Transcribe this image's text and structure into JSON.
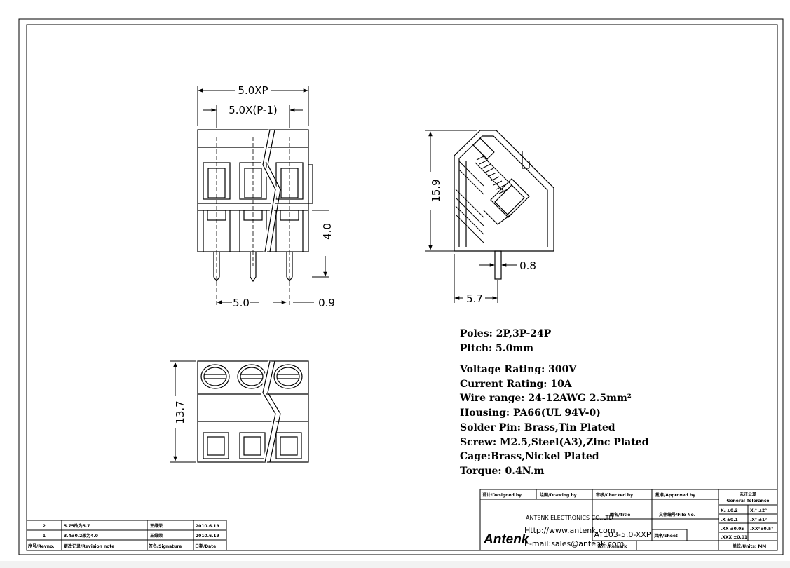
{
  "dimensions": {
    "total_width": "5.0XP",
    "inner_width": "5.0X(P-1)",
    "pitch": "5.0",
    "pin_diameter": "0.9",
    "pin_length": "4.0",
    "height": "15.9",
    "pin_width": "0.8",
    "pin_offset": "5.7",
    "depth": "13.7"
  },
  "specs": [
    "Poles: 2P,3P-24P",
    "Pitch: 5.0mm",
    "Voltage Rating: 300V",
    "Current Rating: 10A",
    "Wire range: 24-12AWG 2.5mm²",
    "Housing: PA66(UL 94V-0)",
    "Solder Pin: Brass,Tin Plated",
    "Screw: M2.5,Steel(A3),Zinc Plated",
    "Cage:Brass,Nickel Plated",
    "Torque: 0.4N.m"
  ],
  "title_block": {
    "designed_by": "设计/Designed by",
    "drawing_by": "绘图/Drawing by",
    "checked_by": "审核/Checked by",
    "approved_by": "批准/Approved by",
    "tolerance_title": "未注公差",
    "tolerance_sub": "General Tolerance",
    "tol_a1": "X.  ±0.2",
    "tol_a2": ".X  ±0.1",
    "tol_a3": ".XX ±0.05",
    "tol_a4": ".XXX ±0.01",
    "tol_b1": "X.° ±2°",
    "tol_b2": ".X° ±1°",
    "tol_b3": ".XX°±0.5°",
    "logo": "Antenk",
    "company": "ANTENK ELECTRONICS CO.,LTD",
    "http": "Http://www.antenk.com",
    "email": "E-mail:sales@antenk.com",
    "title_label": "图名/Title",
    "file_label": "文件编号/File No.",
    "part_no": "AT103-5.0-XXP",
    "sheet_label": "页序/Sheet",
    "remark_label": "备注 /Remark",
    "unit_label": "单位/Units: MM"
  },
  "revisions": [
    {
      "no": "2",
      "note": "5.75改为5.7",
      "sign": "王维荣",
      "date": "2010.6.19"
    },
    {
      "no": "1",
      "note": "3.4±0.2改为4.0",
      "sign": "王维荣",
      "date": "2010.6.19"
    }
  ],
  "revision_header": {
    "no": "序号/Revno.",
    "note": "更改记录/Revision note",
    "sign": "签名/Signature",
    "date": "日期/Date"
  }
}
